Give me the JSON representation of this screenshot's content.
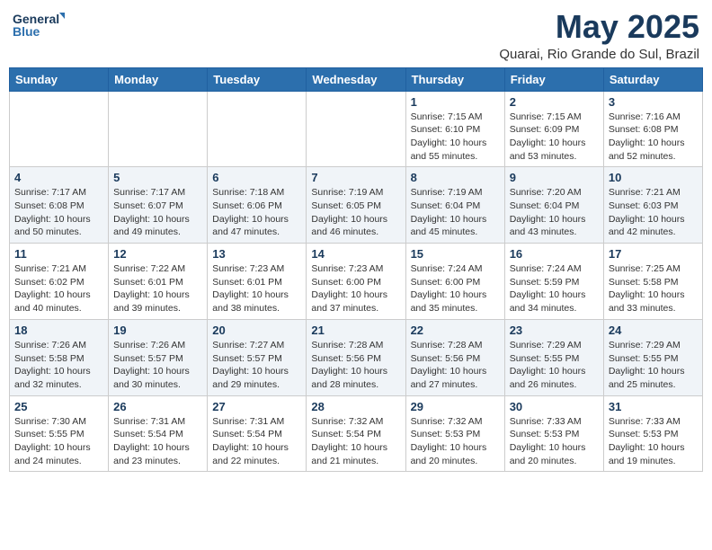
{
  "header": {
    "logo_line1": "General",
    "logo_line2": "Blue",
    "month": "May 2025",
    "location": "Quarai, Rio Grande do Sul, Brazil"
  },
  "weekdays": [
    "Sunday",
    "Monday",
    "Tuesday",
    "Wednesday",
    "Thursday",
    "Friday",
    "Saturday"
  ],
  "rows": [
    [
      {
        "day": "",
        "info": ""
      },
      {
        "day": "",
        "info": ""
      },
      {
        "day": "",
        "info": ""
      },
      {
        "day": "",
        "info": ""
      },
      {
        "day": "1",
        "info": "Sunrise: 7:15 AM\nSunset: 6:10 PM\nDaylight: 10 hours\nand 55 minutes."
      },
      {
        "day": "2",
        "info": "Sunrise: 7:15 AM\nSunset: 6:09 PM\nDaylight: 10 hours\nand 53 minutes."
      },
      {
        "day": "3",
        "info": "Sunrise: 7:16 AM\nSunset: 6:08 PM\nDaylight: 10 hours\nand 52 minutes."
      }
    ],
    [
      {
        "day": "4",
        "info": "Sunrise: 7:17 AM\nSunset: 6:08 PM\nDaylight: 10 hours\nand 50 minutes."
      },
      {
        "day": "5",
        "info": "Sunrise: 7:17 AM\nSunset: 6:07 PM\nDaylight: 10 hours\nand 49 minutes."
      },
      {
        "day": "6",
        "info": "Sunrise: 7:18 AM\nSunset: 6:06 PM\nDaylight: 10 hours\nand 47 minutes."
      },
      {
        "day": "7",
        "info": "Sunrise: 7:19 AM\nSunset: 6:05 PM\nDaylight: 10 hours\nand 46 minutes."
      },
      {
        "day": "8",
        "info": "Sunrise: 7:19 AM\nSunset: 6:04 PM\nDaylight: 10 hours\nand 45 minutes."
      },
      {
        "day": "9",
        "info": "Sunrise: 7:20 AM\nSunset: 6:04 PM\nDaylight: 10 hours\nand 43 minutes."
      },
      {
        "day": "10",
        "info": "Sunrise: 7:21 AM\nSunset: 6:03 PM\nDaylight: 10 hours\nand 42 minutes."
      }
    ],
    [
      {
        "day": "11",
        "info": "Sunrise: 7:21 AM\nSunset: 6:02 PM\nDaylight: 10 hours\nand 40 minutes."
      },
      {
        "day": "12",
        "info": "Sunrise: 7:22 AM\nSunset: 6:01 PM\nDaylight: 10 hours\nand 39 minutes."
      },
      {
        "day": "13",
        "info": "Sunrise: 7:23 AM\nSunset: 6:01 PM\nDaylight: 10 hours\nand 38 minutes."
      },
      {
        "day": "14",
        "info": "Sunrise: 7:23 AM\nSunset: 6:00 PM\nDaylight: 10 hours\nand 37 minutes."
      },
      {
        "day": "15",
        "info": "Sunrise: 7:24 AM\nSunset: 6:00 PM\nDaylight: 10 hours\nand 35 minutes."
      },
      {
        "day": "16",
        "info": "Sunrise: 7:24 AM\nSunset: 5:59 PM\nDaylight: 10 hours\nand 34 minutes."
      },
      {
        "day": "17",
        "info": "Sunrise: 7:25 AM\nSunset: 5:58 PM\nDaylight: 10 hours\nand 33 minutes."
      }
    ],
    [
      {
        "day": "18",
        "info": "Sunrise: 7:26 AM\nSunset: 5:58 PM\nDaylight: 10 hours\nand 32 minutes."
      },
      {
        "day": "19",
        "info": "Sunrise: 7:26 AM\nSunset: 5:57 PM\nDaylight: 10 hours\nand 30 minutes."
      },
      {
        "day": "20",
        "info": "Sunrise: 7:27 AM\nSunset: 5:57 PM\nDaylight: 10 hours\nand 29 minutes."
      },
      {
        "day": "21",
        "info": "Sunrise: 7:28 AM\nSunset: 5:56 PM\nDaylight: 10 hours\nand 28 minutes."
      },
      {
        "day": "22",
        "info": "Sunrise: 7:28 AM\nSunset: 5:56 PM\nDaylight: 10 hours\nand 27 minutes."
      },
      {
        "day": "23",
        "info": "Sunrise: 7:29 AM\nSunset: 5:55 PM\nDaylight: 10 hours\nand 26 minutes."
      },
      {
        "day": "24",
        "info": "Sunrise: 7:29 AM\nSunset: 5:55 PM\nDaylight: 10 hours\nand 25 minutes."
      }
    ],
    [
      {
        "day": "25",
        "info": "Sunrise: 7:30 AM\nSunset: 5:55 PM\nDaylight: 10 hours\nand 24 minutes."
      },
      {
        "day": "26",
        "info": "Sunrise: 7:31 AM\nSunset: 5:54 PM\nDaylight: 10 hours\nand 23 minutes."
      },
      {
        "day": "27",
        "info": "Sunrise: 7:31 AM\nSunset: 5:54 PM\nDaylight: 10 hours\nand 22 minutes."
      },
      {
        "day": "28",
        "info": "Sunrise: 7:32 AM\nSunset: 5:54 PM\nDaylight: 10 hours\nand 21 minutes."
      },
      {
        "day": "29",
        "info": "Sunrise: 7:32 AM\nSunset: 5:53 PM\nDaylight: 10 hours\nand 20 minutes."
      },
      {
        "day": "30",
        "info": "Sunrise: 7:33 AM\nSunset: 5:53 PM\nDaylight: 10 hours\nand 20 minutes."
      },
      {
        "day": "31",
        "info": "Sunrise: 7:33 AM\nSunset: 5:53 PM\nDaylight: 10 hours\nand 19 minutes."
      }
    ]
  ]
}
